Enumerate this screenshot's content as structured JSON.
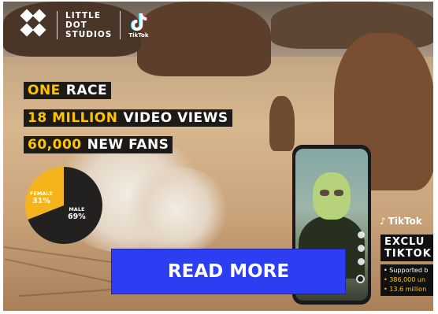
{
  "brand": {
    "studio_line1": "LITTLE",
    "studio_line2": "DOT",
    "studio_line3": "STUDIOS",
    "tiktok_label": "TikTok"
  },
  "headlines": [
    {
      "highlight": "ONE",
      "rest": "RACE"
    },
    {
      "highlight": "18 MILLION",
      "rest": "VIDEO VIEWS"
    },
    {
      "highlight": "60,000",
      "rest": "NEW FANS"
    }
  ],
  "audience": {
    "female_label": "FEMALE",
    "female_value": "31%",
    "male_label": "MALE",
    "male_value": "69%",
    "female_share": 31,
    "male_share": 69
  },
  "promo": {
    "tiktok_label": "TikTok",
    "exclusive_line1": "EXCLU",
    "exclusive_line2": "TIKTOK",
    "stat1": "Supported b",
    "stat2": "386,000 un",
    "stat3": "13.6 million"
  },
  "cta": {
    "label": "READ MORE"
  },
  "colors": {
    "accent": "#ffc400",
    "cta": "#2d3df2",
    "dark": "#1e1a17"
  }
}
